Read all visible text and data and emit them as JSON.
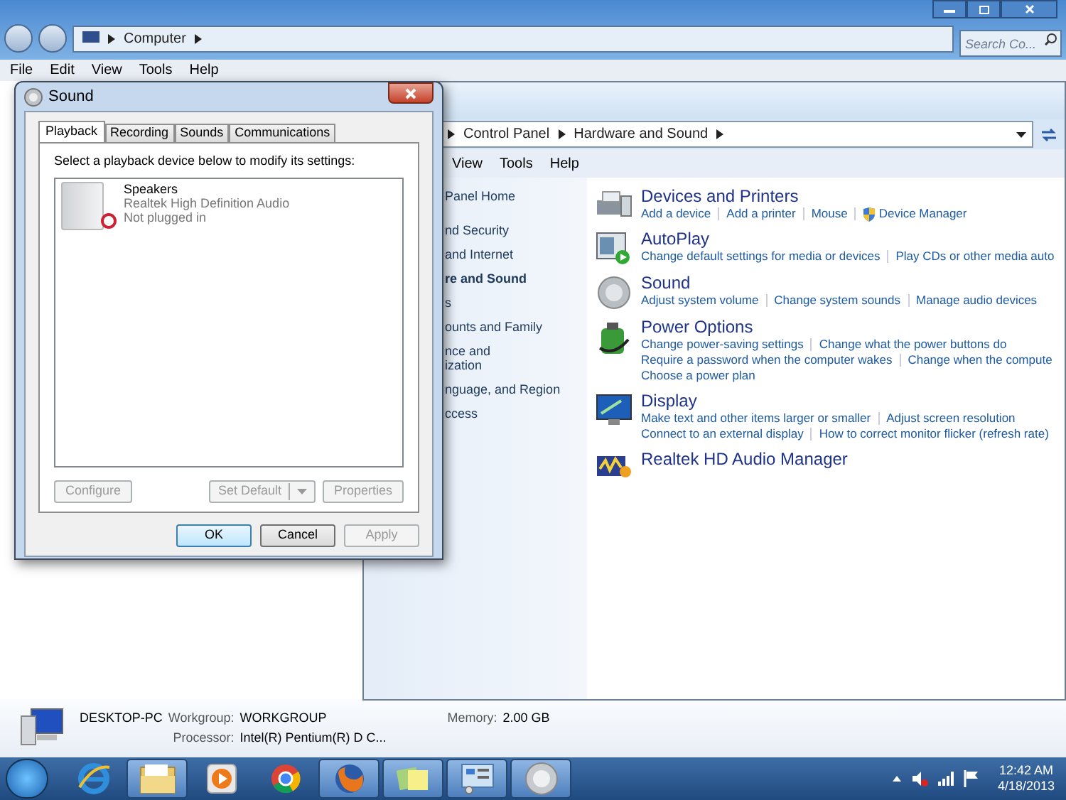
{
  "explorer": {
    "address": [
      "Computer"
    ],
    "search": {
      "placeholder": "Search Co..."
    },
    "menu": [
      "File",
      "Edit",
      "View",
      "Tools",
      "Help"
    ]
  },
  "control_panel": {
    "address": [
      "Control Panel",
      "Hardware and Sound"
    ],
    "menu": [
      "View",
      "Tools",
      "Help"
    ],
    "nav": [
      {
        "lines": [
          "Panel Home"
        ],
        "selected": false
      },
      {
        "lines": [
          "nd Security"
        ],
        "selected": false
      },
      {
        "lines": [
          "and Internet"
        ],
        "selected": false
      },
      {
        "lines": [
          "re and Sound"
        ],
        "selected": true
      },
      {
        "lines": [
          "s"
        ],
        "selected": false
      },
      {
        "lines": [
          "ounts and Family"
        ],
        "selected": false
      },
      {
        "lines": [
          "nce and",
          "ization"
        ],
        "selected": false
      },
      {
        "lines": [
          "nguage, and Region"
        ],
        "selected": false
      },
      {
        "lines": [
          "ccess"
        ],
        "selected": false
      }
    ],
    "categories": [
      {
        "title": "Devices and Printers",
        "kind": "printer",
        "link_lines": [
          [
            {
              "text": "Add a device",
              "shield": false
            },
            {
              "text": "Add a printer",
              "shield": false
            },
            {
              "text": "Mouse",
              "shield": false
            },
            {
              "text": "Device Manager",
              "shield": true
            }
          ]
        ]
      },
      {
        "title": "AutoPlay",
        "kind": "autoplay",
        "link_lines": [
          [
            {
              "text": "Change default settings for media or devices",
              "shield": false
            },
            {
              "text": "Play CDs or other media auto",
              "shield": false
            }
          ]
        ]
      },
      {
        "title": "Sound",
        "kind": "speaker",
        "link_lines": [
          [
            {
              "text": "Adjust system volume",
              "shield": false
            },
            {
              "text": "Change system sounds",
              "shield": false
            },
            {
              "text": "Manage audio devices",
              "shield": false
            }
          ]
        ]
      },
      {
        "title": "Power Options",
        "kind": "power",
        "link_lines": [
          [
            {
              "text": "Change power-saving settings",
              "shield": false
            },
            {
              "text": "Change what the power buttons do",
              "shield": false
            }
          ],
          [
            {
              "text": "Require a password when the computer wakes",
              "shield": false
            },
            {
              "text": "Change when the compute",
              "shield": false
            }
          ],
          [
            {
              "text": "Choose a power plan",
              "shield": false
            }
          ]
        ]
      },
      {
        "title": "Display",
        "kind": "display",
        "link_lines": [
          [
            {
              "text": "Make text and other items larger or smaller",
              "shield": false
            },
            {
              "text": "Adjust screen resolution",
              "shield": false
            }
          ],
          [
            {
              "text": "Connect to an external display",
              "shield": false
            },
            {
              "text": "How to correct monitor flicker (refresh rate)",
              "shield": false
            }
          ]
        ]
      },
      {
        "title": "Realtek HD Audio Manager",
        "kind": "realtek"
      }
    ]
  },
  "sound_dialog": {
    "title": "Sound",
    "tabs": [
      {
        "label": "Playback",
        "selected": true
      },
      {
        "label": "Recording",
        "selected": false
      },
      {
        "label": "Sounds",
        "selected": false
      },
      {
        "label": "Communications",
        "selected": false
      }
    ],
    "instruction": "Select a playback device below to modify its settings:",
    "devices": [
      {
        "name": "Speakers",
        "driver": "Realtek High Definition Audio",
        "status": "Not plugged in"
      }
    ],
    "buttons": [
      {
        "label": "Configure",
        "kind": "plain",
        "disabled": true
      },
      {
        "label": "Set Default",
        "kind": "split",
        "disabled": true
      },
      {
        "label": "Properties",
        "kind": "plain",
        "disabled": true
      }
    ],
    "footer_buttons": [
      {
        "label": "OK",
        "default": true,
        "disabled": false
      },
      {
        "label": "Cancel",
        "default": false,
        "disabled": false
      },
      {
        "label": "Apply",
        "default": false,
        "disabled": true
      }
    ]
  },
  "details": {
    "name": "DESKTOP-PC",
    "fields": [
      {
        "label": "Workgroup:",
        "value": "WORKGROUP"
      },
      {
        "label": "Memory:",
        "value": "2.00 GB"
      },
      {
        "label": "Processor:",
        "value": "Intel(R) Pentium(R) D C..."
      }
    ]
  },
  "taskbar": {
    "apps": [
      {
        "kind": "ie",
        "open": false
      },
      {
        "kind": "folder",
        "open": true
      },
      {
        "kind": "media",
        "open": false
      },
      {
        "kind": "chrome",
        "open": false
      },
      {
        "kind": "firefox",
        "open": true
      },
      {
        "kind": "notes",
        "open": true
      },
      {
        "kind": "panel",
        "open": true
      },
      {
        "kind": "speaker",
        "open": true
      }
    ],
    "clock": {
      "time": "12:42 AM",
      "date": "4/18/2013"
    }
  }
}
